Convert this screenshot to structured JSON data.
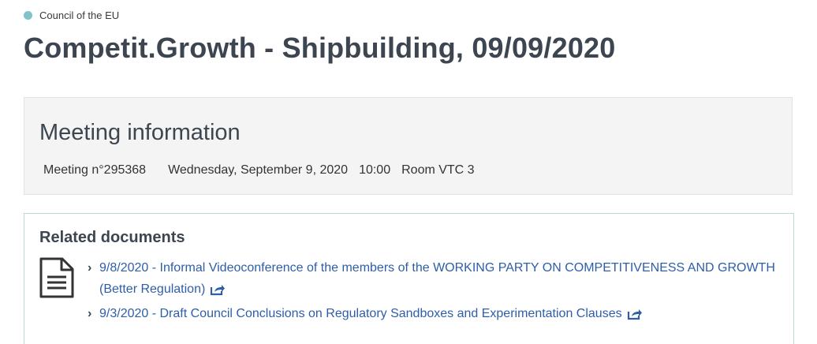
{
  "header": {
    "organization": "Council of the EU",
    "title": "Competit.Growth - Shipbuilding, 09/09/2020"
  },
  "meeting": {
    "heading": "Meeting information",
    "number": "Meeting n°295368",
    "date": "Wednesday, September 9, 2020",
    "time": "10:00",
    "room": "Room VTC 3"
  },
  "related": {
    "heading": "Related documents",
    "items": [
      {
        "text": "9/8/2020 - Informal Videoconference of the members of the WORKING PARTY ON COMPETITIVENESS AND GROWTH (Better Regulation)"
      },
      {
        "text": "9/3/2020 - Draft Council Conclusions on Regulatory Sandboxes and Experimentation Clauses"
      }
    ]
  },
  "colors": {
    "accent_dot": "#7fc4c6",
    "link": "#2e5ea8",
    "heading": "#3d4650"
  }
}
